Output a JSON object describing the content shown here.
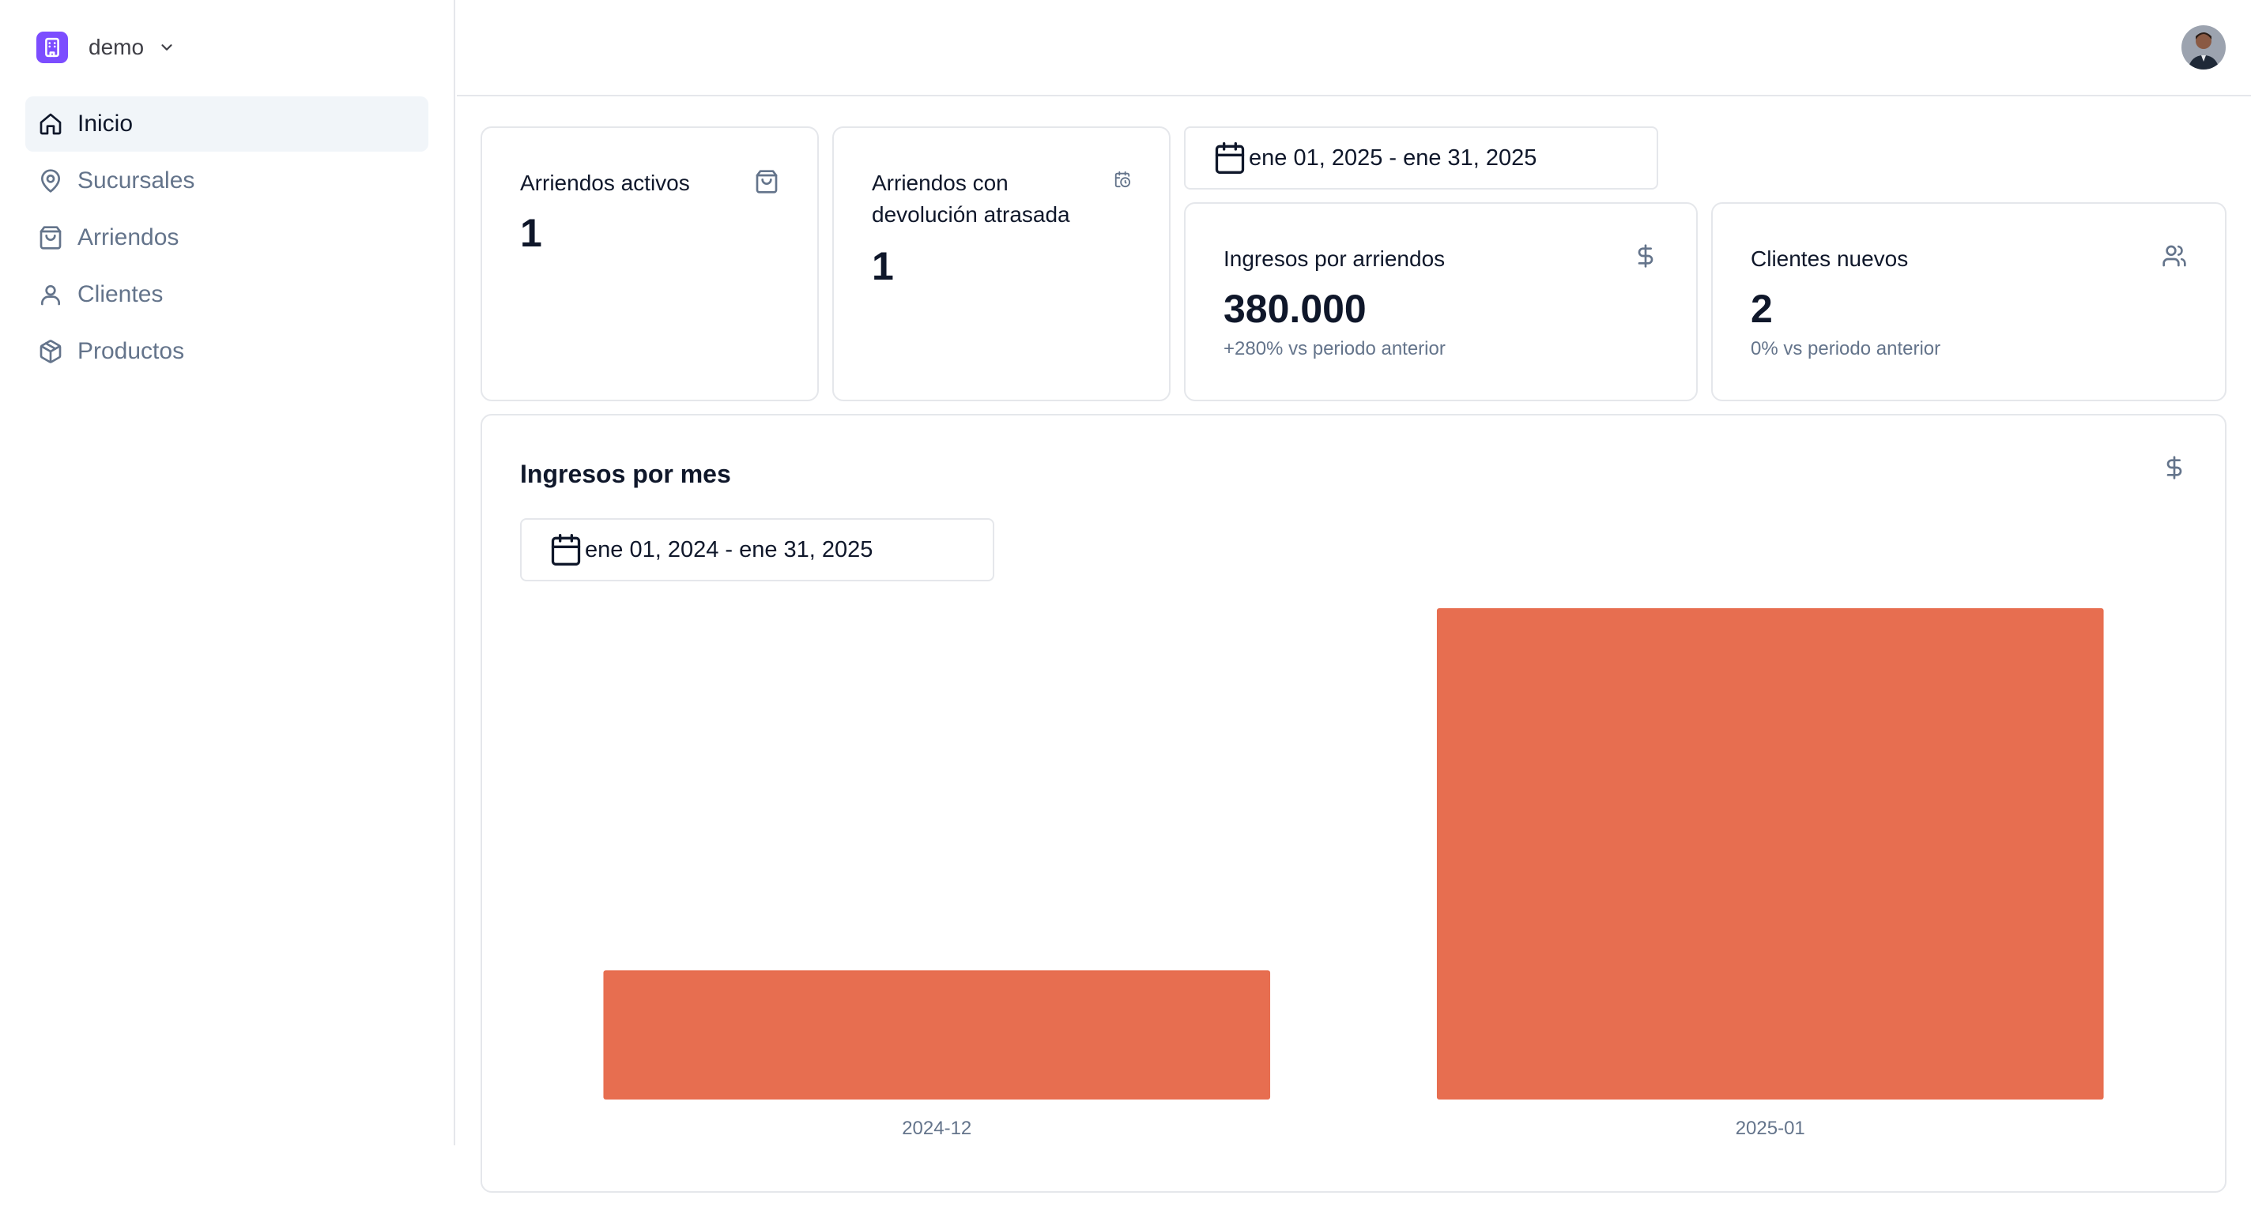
{
  "org": {
    "name": "demo"
  },
  "sidebar": {
    "items": [
      {
        "label": "Inicio",
        "icon": "home-icon",
        "active": true
      },
      {
        "label": "Sucursales",
        "icon": "map-pin-icon",
        "active": false
      },
      {
        "label": "Arriendos",
        "icon": "shopping-bag-icon",
        "active": false
      },
      {
        "label": "Clientes",
        "icon": "user-icon",
        "active": false
      },
      {
        "label": "Productos",
        "icon": "package-icon",
        "active": false
      }
    ]
  },
  "stats": {
    "active_rentals": {
      "title": "Arriendos activos",
      "value": "1",
      "icon": "shopping-bag-icon"
    },
    "late_returns": {
      "title_line1": "Arriendos con",
      "title_line2": "devolución atrasada",
      "value": "1",
      "icon": "calendar-clock-icon"
    },
    "date_range": "ene 01, 2025 - ene 31, 2025",
    "revenue": {
      "title": "Ingresos por arriendos",
      "value": "380.000",
      "sub": "+280% vs periodo anterior",
      "icon": "dollar-icon"
    },
    "new_clients": {
      "title": "Clientes nuevos",
      "value": "2",
      "sub": "0% vs periodo anterior",
      "icon": "users-icon"
    }
  },
  "monthly": {
    "title": "Ingresos por mes",
    "date_range": "ene 01, 2024 - ene 31, 2025",
    "icon": "dollar-icon"
  },
  "colors": {
    "bar": "#e76e50",
    "accent": "#7c4dff"
  },
  "chart_data": {
    "type": "bar",
    "categories": [
      "2024-12",
      "2025-01"
    ],
    "values": [
      100000,
      380000
    ],
    "title": "Ingresos por mes",
    "xlabel": "",
    "ylabel": "",
    "grid": false
  }
}
